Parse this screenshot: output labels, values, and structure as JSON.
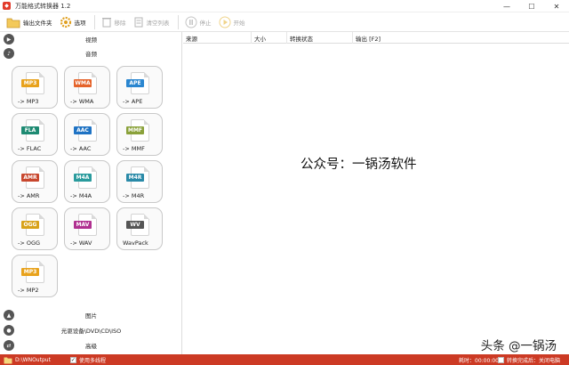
{
  "window": {
    "title": "万能格式转换器 1.2",
    "controls": {
      "minimize": "—",
      "maximize": "☐",
      "close": "✕"
    }
  },
  "toolbar": {
    "output_folder_label": "输出文件夹",
    "options_label": "选项",
    "remove_label": "移除",
    "clear_list_label": "清空列表",
    "stop_label": "停止",
    "start_label": "开始"
  },
  "sidebar": {
    "video_label": "视频",
    "audio_label": "音频",
    "picture_label": "图片",
    "rom_label": "光驱设备\\DVD\\CD\\ISO",
    "advanced_label": "高级"
  },
  "formats": [
    {
      "badge": "MP3",
      "label": "-> MP3",
      "color": "#e8a21c"
    },
    {
      "badge": "WMA",
      "label": "-> WMA",
      "color": "#e5632a"
    },
    {
      "badge": "APE",
      "label": "-> APE",
      "color": "#2a86d0"
    },
    {
      "badge": "FLA",
      "label": "-> FLAC",
      "color": "#1d8a72"
    },
    {
      "badge": "AAC",
      "label": "-> AAC",
      "color": "#1f73c4"
    },
    {
      "badge": "MMF",
      "label": "-> MMF",
      "color": "#8aa13a"
    },
    {
      "badge": "AMR",
      "label": "-> AMR",
      "color": "#c8472e"
    },
    {
      "badge": "M4A",
      "label": "-> M4A",
      "color": "#2a9b9d"
    },
    {
      "badge": "M4R",
      "label": "-> M4R",
      "color": "#2a8aa8"
    },
    {
      "badge": "OGG",
      "label": "-> OGG",
      "color": "#d8a21a"
    },
    {
      "badge": "MAV",
      "label": "-> WAV",
      "color": "#b03090"
    },
    {
      "badge": "WV",
      "label": "WavPack",
      "color": "#555555"
    },
    {
      "badge": "MP3",
      "label": "-> MP2",
      "color": "#e8a21c"
    }
  ],
  "table": {
    "columns": [
      "来源",
      "大小",
      "转换状态",
      "输出 [F2]"
    ]
  },
  "overlay": {
    "center_text": "公众号：一锅汤软件",
    "corner_text": "头条 @一锅汤"
  },
  "status": {
    "output_path": "D:\\WNOutput",
    "multithread_label": "使用多线程",
    "elapsed_label": "耗时：00:00:00",
    "after_convert_label": "转换完成后：关闭电脑"
  },
  "colors": {
    "accent": "#cc3a24",
    "status_bar": "#cc3a24"
  }
}
